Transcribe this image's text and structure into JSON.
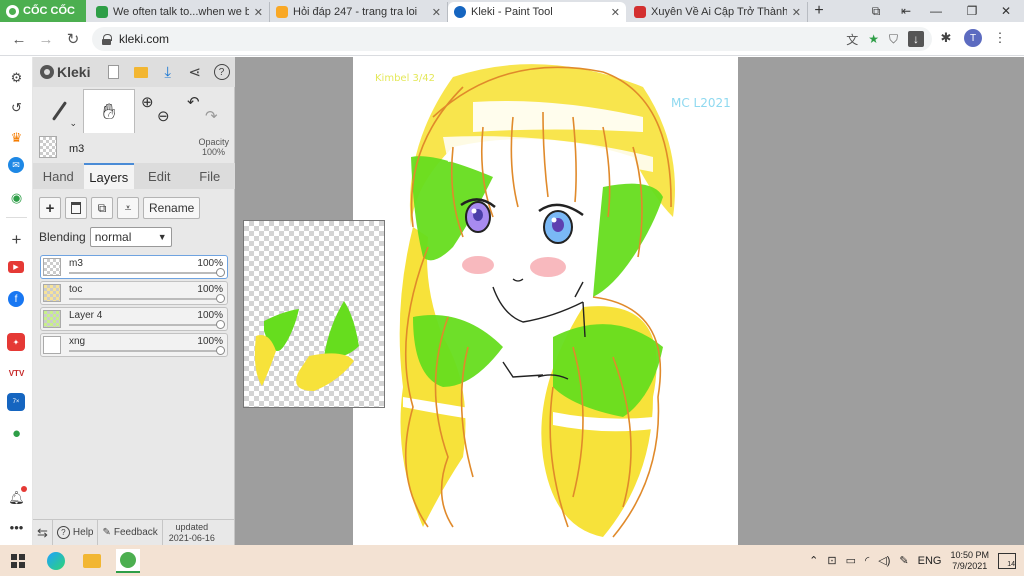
{
  "browser": {
    "brand": "CỐC CỐC",
    "tabs": [
      {
        "title": "We often talk to...when we b",
        "close": "✕",
        "color": "#2e9e47"
      },
      {
        "title": "Hỏi đáp 247 - trang tra loi",
        "close": "✕",
        "color": "#1e88e5"
      },
      {
        "title": "Kleki - Paint Tool",
        "close": "✕",
        "color": "#1565c0"
      },
      {
        "title": "Xuyên Về Ai Cập Trở Thành S",
        "close": "✕",
        "color": "#d32f2f"
      }
    ],
    "new_tab": "+",
    "url": "kleki.com",
    "avatar_letter": "T"
  },
  "kleki": {
    "logo": "Kleki",
    "layer_name": "m3",
    "opacity_label": "Opacity",
    "opacity_value": "100%",
    "tabs": [
      "Hand",
      "Layers",
      "Edit",
      "File"
    ],
    "rename_label": "Rename",
    "blending_label": "Blending",
    "blending_value": "normal",
    "layers": [
      {
        "name": "m3",
        "opacity": "100%"
      },
      {
        "name": "toc",
        "opacity": "100%"
      },
      {
        "name": "Layer 4",
        "opacity": "100%"
      },
      {
        "name": "xng",
        "opacity": "100%"
      }
    ],
    "footer": {
      "help": "Help",
      "feedback": "Feedback",
      "updated_label": "updated",
      "updated_date": "2021-06-16"
    }
  },
  "canvas": {
    "signature_left": "Kimbel 3/42",
    "signature_right": "MC L2021"
  },
  "taskbar": {
    "language": "ENG",
    "time": "10:50 PM",
    "date": "7/9/2021",
    "notifications": "14"
  }
}
